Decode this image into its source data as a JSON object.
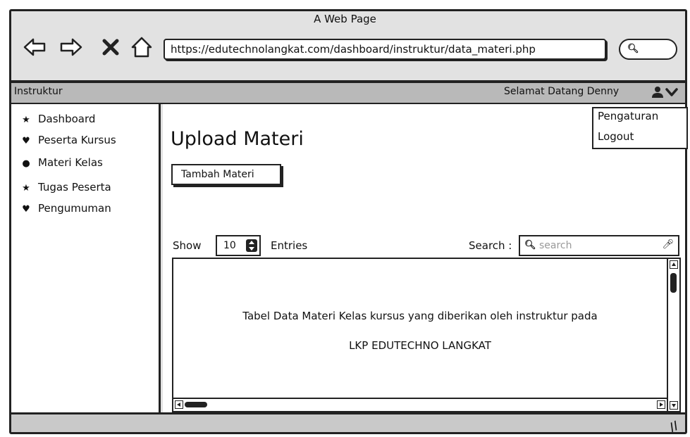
{
  "browser": {
    "title": "A Web Page",
    "url": "https://edutechnolangkat.com/dashboard/instruktur/data_materi.php",
    "icons": [
      "back-arrow-icon",
      "forward-arrow-icon",
      "close-icon",
      "home-icon",
      "search-icon"
    ]
  },
  "header": {
    "role": "Instruktur",
    "welcome": "Selamat Datang Denny",
    "user_menu": [
      "Pengaturan",
      "Logout"
    ]
  },
  "sidebar": {
    "items": [
      {
        "icon": "star-icon",
        "label": "Dashboard"
      },
      {
        "icon": "heart-icon",
        "label": "Peserta Kursus"
      },
      {
        "icon": "circle-icon",
        "label": "Materi Kelas"
      },
      {
        "icon": "star-icon",
        "label": "Tugas Peserta"
      },
      {
        "icon": "heart-icon",
        "label": "Pengumuman"
      }
    ]
  },
  "main": {
    "title": "Upload Materi",
    "add_button": "Tambah Materi",
    "show_label": "Show",
    "entries_value": "10",
    "entries_label": "Entries",
    "search_label": "Search :",
    "search_placeholder": "search",
    "table_text_line1": "Tabel Data Materi Kelas kursus yang diberikan oleh instruktur pada",
    "table_text_line2": "LKP EDUTECHNO LANGKAT"
  },
  "colors": {
    "header_bg": "#b9b9b9",
    "chrome_bg": "#e2e2e2",
    "border": "#222222"
  }
}
